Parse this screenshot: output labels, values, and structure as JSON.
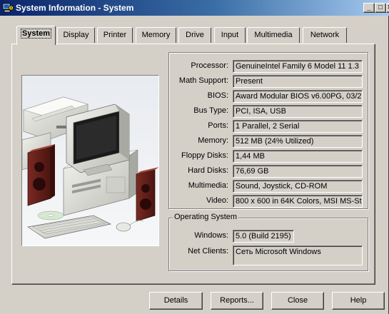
{
  "window": {
    "title": "System Information - System",
    "minimize_glyph": "_",
    "maximize_glyph": "□",
    "close_glyph": "×"
  },
  "tabs": [
    {
      "label": "System",
      "active": true
    },
    {
      "label": "Display"
    },
    {
      "label": "Printer"
    },
    {
      "label": "Memory"
    },
    {
      "label": "Drive"
    },
    {
      "label": "Input"
    },
    {
      "label": "Multimedia"
    },
    {
      "label": "Network"
    }
  ],
  "hardware": {
    "processor_label": "Processor:",
    "processor_value": "GenuineIntel Family 6 Model 11 1.3",
    "math_label": "Math Support:",
    "math_value": "Present",
    "bios_label": "BIOS:",
    "bios_value": "Award Modular BIOS v6.00PG, 03/2",
    "bus_label": "Bus Type:",
    "bus_value": "PCI, ISA, USB",
    "ports_label": "Ports:",
    "ports_value": "1 Parallel, 2 Serial",
    "memory_label": "Memory:",
    "memory_value": "512 MB  (24% Utilized)",
    "floppy_label": "Floppy Disks:",
    "floppy_value": "1,44 MB",
    "hard_label": "Hard Disks:",
    "hard_value": "76,69 GB",
    "multimedia_label": "Multimedia:",
    "multimedia_value": "Sound, Joystick, CD-ROM",
    "video_label": "Video:",
    "video_value": "800 x 600 in 64K Colors, MSI MS-St"
  },
  "os": {
    "group_title": "Operating System",
    "windows_label": "Windows:",
    "windows_value": "5.0 (Build 2195)",
    "net_label": "Net Clients:",
    "net_value": "Сеть Microsoft Windows"
  },
  "buttons": {
    "details": "Details",
    "reports": "Reports...",
    "close": "Close",
    "help": "Help"
  },
  "colors": {
    "face": "#d4d0c8",
    "title_start": "#0a246a",
    "title_end": "#a6caf0"
  }
}
